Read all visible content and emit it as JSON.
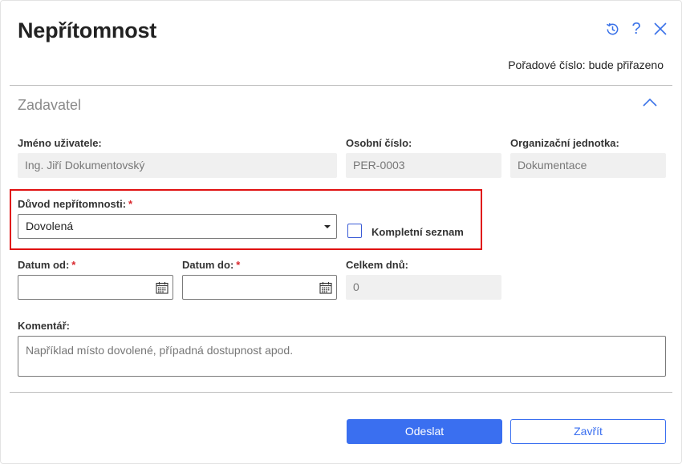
{
  "dialog": {
    "title": "Nepřítomnost",
    "order_number": "Pořadové číslo: bude přiřazeno",
    "icons": [
      "history-icon",
      "help-icon",
      "close-icon"
    ]
  },
  "section": {
    "title": "Zadavatel",
    "collapse_icon": "chevron-up-icon"
  },
  "fields": {
    "username": {
      "label": "Jméno uživatele:",
      "value": "Ing. Jiří Dokumentovský"
    },
    "personal_number": {
      "label": "Osobní číslo:",
      "value": "PER-0003"
    },
    "org_unit": {
      "label": "Organizační jednotka:",
      "value": "Dokumentace"
    },
    "reason": {
      "label": "Důvod nepřítomnosti:",
      "required": "*",
      "value": "Dovolená"
    },
    "full_list": {
      "label": "Kompletní seznam",
      "checked": false
    },
    "date_from": {
      "label": "Datum od:",
      "required": "*",
      "value": ""
    },
    "date_to": {
      "label": "Datum do:",
      "required": "*",
      "value": ""
    },
    "total_days": {
      "label": "Celkem dnů:",
      "value": "0"
    },
    "comment": {
      "label": "Komentář:",
      "placeholder": "Například místo dovolené, případná dostupnost apod."
    }
  },
  "buttons": {
    "submit": "Odeslat",
    "close": "Zavřít"
  },
  "colors": {
    "accent": "#3a6ff0",
    "required": "#d9262c",
    "highlight": "#e01212"
  }
}
